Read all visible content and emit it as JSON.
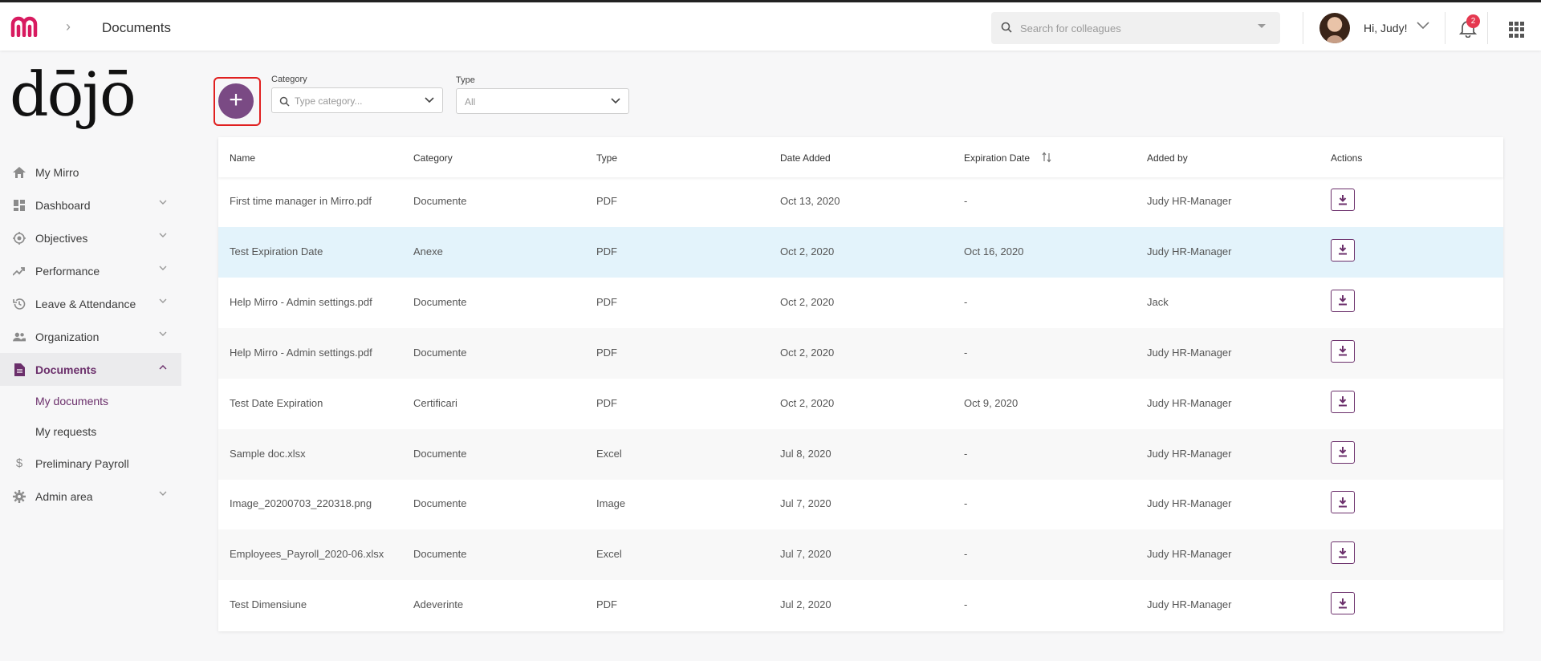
{
  "header": {
    "breadcrumb_title": "Documents",
    "search_placeholder": "Search for colleagues",
    "greeting": "Hi, Judy!",
    "notifications_count": "2"
  },
  "brand": {
    "logo_text": "dōjō"
  },
  "sidebar": {
    "items": [
      {
        "label": "My Mirro",
        "icon": "home-icon"
      },
      {
        "label": "Dashboard",
        "icon": "dashboard-icon"
      },
      {
        "label": "Objectives",
        "icon": "target-icon"
      },
      {
        "label": "Performance",
        "icon": "trend-icon"
      },
      {
        "label": "Leave & Attendance",
        "icon": "history-icon"
      },
      {
        "label": "Organization",
        "icon": "people-icon"
      },
      {
        "label": "Documents",
        "icon": "document-icon"
      },
      {
        "label": "Preliminary Payroll",
        "icon": "dollar-icon"
      },
      {
        "label": "Admin area",
        "icon": "gear-icon"
      }
    ],
    "sub_items": [
      {
        "label": "My documents"
      },
      {
        "label": "My requests"
      }
    ]
  },
  "filters": {
    "category_label": "Category",
    "category_placeholder": "Type category...",
    "type_label": "Type",
    "type_value": "All"
  },
  "table": {
    "headers": [
      "Name",
      "Category",
      "Type",
      "Date Added",
      "Expiration Date",
      "Added by",
      "Actions"
    ],
    "rows": [
      {
        "name": "First time manager in Mirro.pdf",
        "category": "Documente",
        "type": "PDF",
        "date_added": "Oct 13, 2020",
        "expiration": "-",
        "added_by": "Judy HR-Manager"
      },
      {
        "name": "Test Expiration Date",
        "category": "Anexe",
        "type": "PDF",
        "date_added": "Oct 2, 2020",
        "expiration": "Oct 16, 2020",
        "added_by": "Judy HR-Manager"
      },
      {
        "name": "Help Mirro - Admin settings.pdf",
        "category": "Documente",
        "type": "PDF",
        "date_added": "Oct 2, 2020",
        "expiration": "-",
        "added_by": "Jack"
      },
      {
        "name": "Help Mirro - Admin settings.pdf",
        "category": "Documente",
        "type": "PDF",
        "date_added": "Oct 2, 2020",
        "expiration": "-",
        "added_by": "Judy HR-Manager"
      },
      {
        "name": "Test Date Expiration",
        "category": "Certificari",
        "type": "PDF",
        "date_added": "Oct 2, 2020",
        "expiration": "Oct 9, 2020",
        "added_by": "Judy HR-Manager"
      },
      {
        "name": "Sample doc.xlsx",
        "category": "Documente",
        "type": "Excel",
        "date_added": "Jul 8, 2020",
        "expiration": "-",
        "added_by": "Judy HR-Manager"
      },
      {
        "name": "Image_20200703_220318.png",
        "category": "Documente",
        "type": "Image",
        "date_added": "Jul 7, 2020",
        "expiration": "-",
        "added_by": "Judy HR-Manager"
      },
      {
        "name": "Employees_Payroll_2020-06.xlsx",
        "category": "Documente",
        "type": "Excel",
        "date_added": "Jul 7, 2020",
        "expiration": "-",
        "added_by": "Judy HR-Manager"
      },
      {
        "name": "Test Dimensiune",
        "category": "Adeverinte",
        "type": "PDF",
        "date_added": "Jul 2, 2020",
        "expiration": "-",
        "added_by": "Judy HR-Manager"
      }
    ]
  },
  "colors": {
    "accent": "#6b2f6b",
    "add_button": "#7a4a84",
    "highlight_row": "#e3f3fb",
    "logo_pink": "#d81b60",
    "badge_red": "#e53950"
  }
}
